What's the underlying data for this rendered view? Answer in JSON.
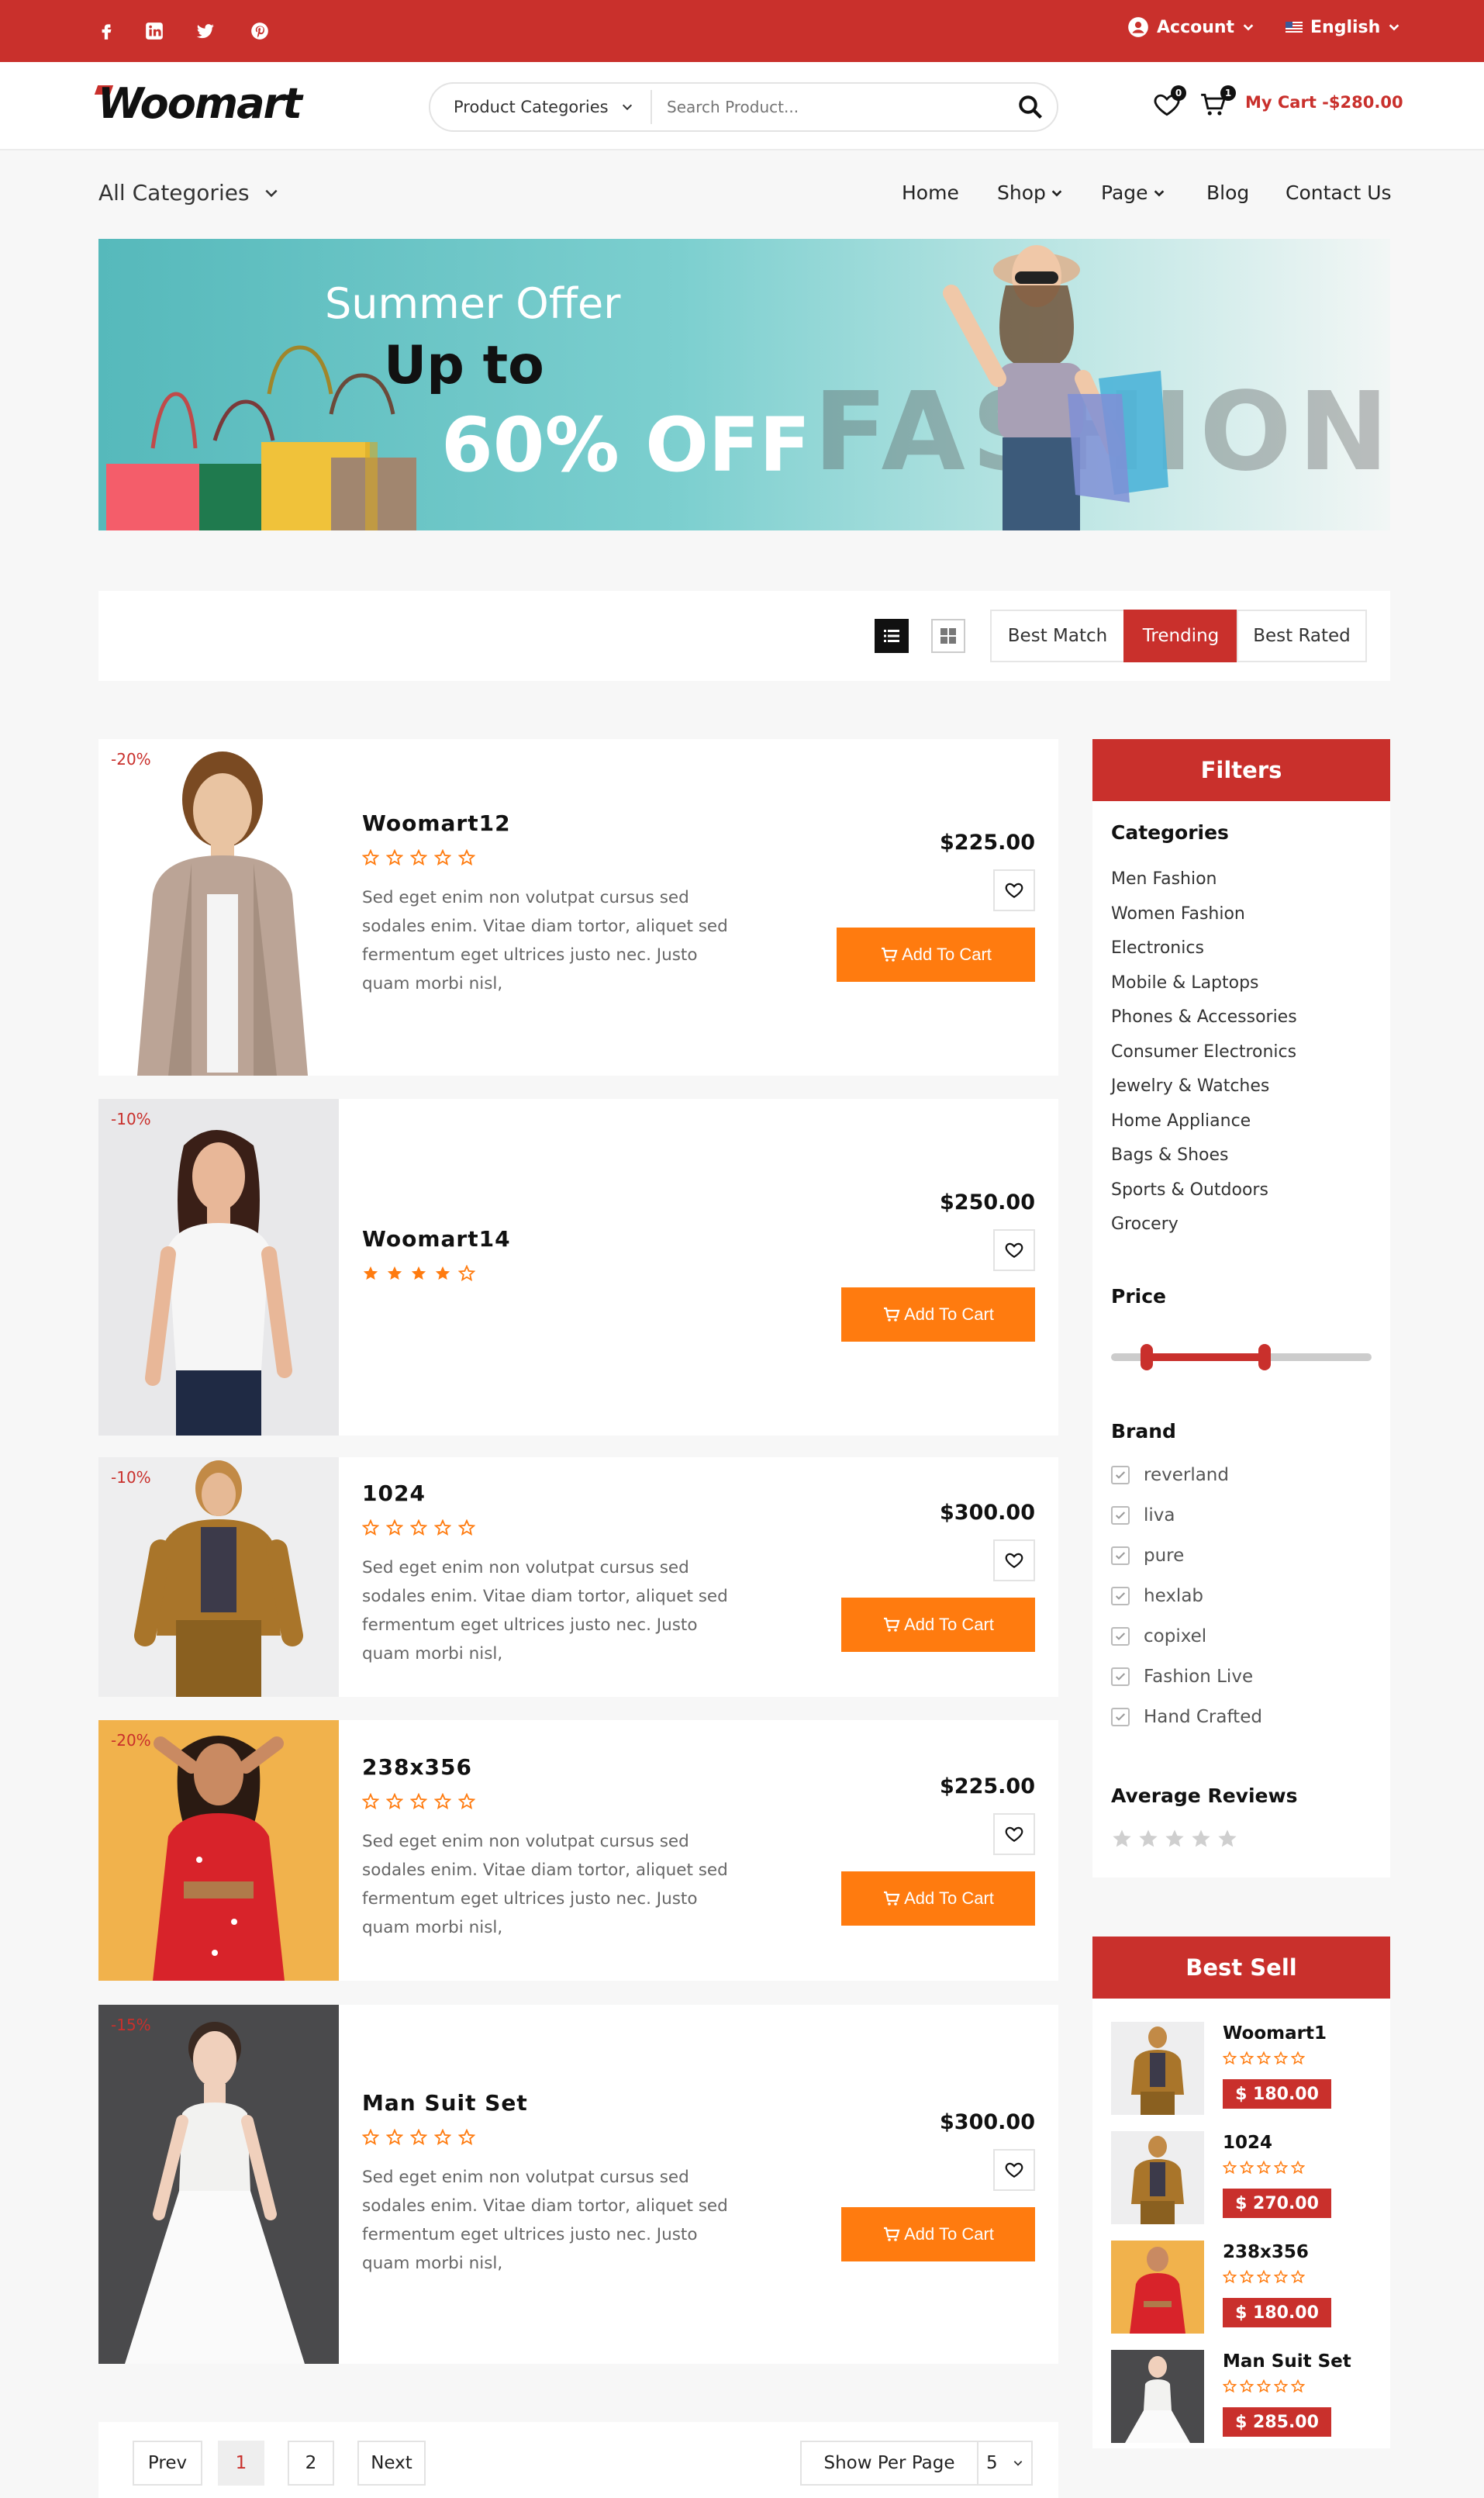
{
  "colors": {
    "brand_red": "#c9302c",
    "orange": "#ff7b0f",
    "star": "#ff7b0f"
  },
  "topbar": {
    "social": [
      "facebook-icon",
      "linkedin-icon",
      "twitter-icon",
      "pinterest-icon"
    ],
    "account_label": "Account",
    "language_label": "English"
  },
  "header": {
    "logo_text": "Woomart",
    "category_select": "Product Categories",
    "search_placeholder": "Search Product...",
    "wishlist_count": "0",
    "cart_count": "1",
    "cart_label": "My Cart -$280.00"
  },
  "nav": {
    "all_categories": "All Categories",
    "items": [
      {
        "label": "Home",
        "has_dropdown": false
      },
      {
        "label": "Shop",
        "has_dropdown": true
      },
      {
        "label": "Page",
        "has_dropdown": true
      },
      {
        "label": "Blog",
        "has_dropdown": false
      },
      {
        "label": "Contact Us",
        "has_dropdown": false
      }
    ]
  },
  "banner": {
    "line1": "Summer Offer",
    "line2": "Up to",
    "line3": "60% OFF",
    "watermark": "FASHION"
  },
  "sortbar": {
    "tabs": [
      {
        "label": "Best Match",
        "active": false
      },
      {
        "label": "Trending",
        "active": true
      },
      {
        "label": "Best Rated",
        "active": false
      }
    ]
  },
  "products": [
    {
      "discount": "-20%",
      "name": "Woomart12",
      "rating": 0,
      "price": "$225.00",
      "desc": "Sed eget enim non volutpat cursus sed sodales enim. Vitae diam tortor, aliquet sed fermentum eget ultrices justo nec. Justo quam morbi nisl,",
      "cart_label": "Add To Cart",
      "image": "woman-cardigan"
    },
    {
      "discount": "-10%",
      "name": "Woomart14",
      "rating": 4,
      "price": "$250.00",
      "desc": "",
      "cart_label": "Add To Cart",
      "image": "woman-white-blouse"
    },
    {
      "discount": "-10%",
      "name": "1024",
      "rating": 0,
      "price": "$300.00",
      "desc": "Sed eget enim non volutpat cursus sed sodales enim. Vitae diam tortor, aliquet sed fermentum eget ultrices justo nec. Justo quam morbi nisl,",
      "cart_label": "Add To Cart",
      "image": "woman-suede-jacket"
    },
    {
      "discount": "-20%",
      "name": "238x356",
      "rating": 0,
      "price": "$225.00",
      "desc": "Sed eget enim non volutpat cursus sed sodales enim. Vitae diam tortor, aliquet sed fermentum eget ultrices justo nec. Justo quam morbi nisl,",
      "cart_label": "Add To Cart",
      "image": "woman-red-dress"
    },
    {
      "discount": "-15%",
      "name": "Man Suit Set",
      "rating": 0,
      "price": "$300.00",
      "desc": "Sed eget enim non volutpat cursus sed sodales enim. Vitae diam tortor, aliquet sed fermentum eget ultrices justo nec. Justo quam morbi nisl,",
      "cart_label": "Add To Cart",
      "image": "woman-white-gown"
    }
  ],
  "pagination": {
    "prev": "Prev",
    "pages": [
      "1",
      "2"
    ],
    "current": "1",
    "next": "Next",
    "per_page_label": "Show Per Page",
    "per_page_value": "5"
  },
  "filters": {
    "title": "Filters",
    "categories_title": "Categories",
    "categories": [
      "Men Fashion",
      "Women Fashion",
      "Electronics",
      "Mobile & Laptops",
      "Phones & Accessories",
      "Consumer Electronics",
      "Jewelry & Watches",
      "Home Appliance",
      "Bags & Shoes",
      "Sports & Outdoors",
      "Grocery"
    ],
    "price_title": "Price",
    "brand_title": "Brand",
    "brands": [
      "reverland",
      "liva",
      "pure",
      "hexlab",
      "copixel",
      "Fashion Live",
      "Hand Crafted"
    ],
    "reviews_title": "Average Reviews"
  },
  "best_sell": {
    "title": "Best Sell",
    "items": [
      {
        "name": "Woomart1",
        "price": "$ 180.00",
        "image": "woman-suede-jacket"
      },
      {
        "name": "1024",
        "price": "$ 270.00",
        "image": "woman-suede-jacket"
      },
      {
        "name": "238x356",
        "price": "$ 180.00",
        "image": "woman-red-dress"
      },
      {
        "name": "Man Suit Set",
        "price": "$ 285.00",
        "image": "woman-white-gown"
      }
    ]
  }
}
